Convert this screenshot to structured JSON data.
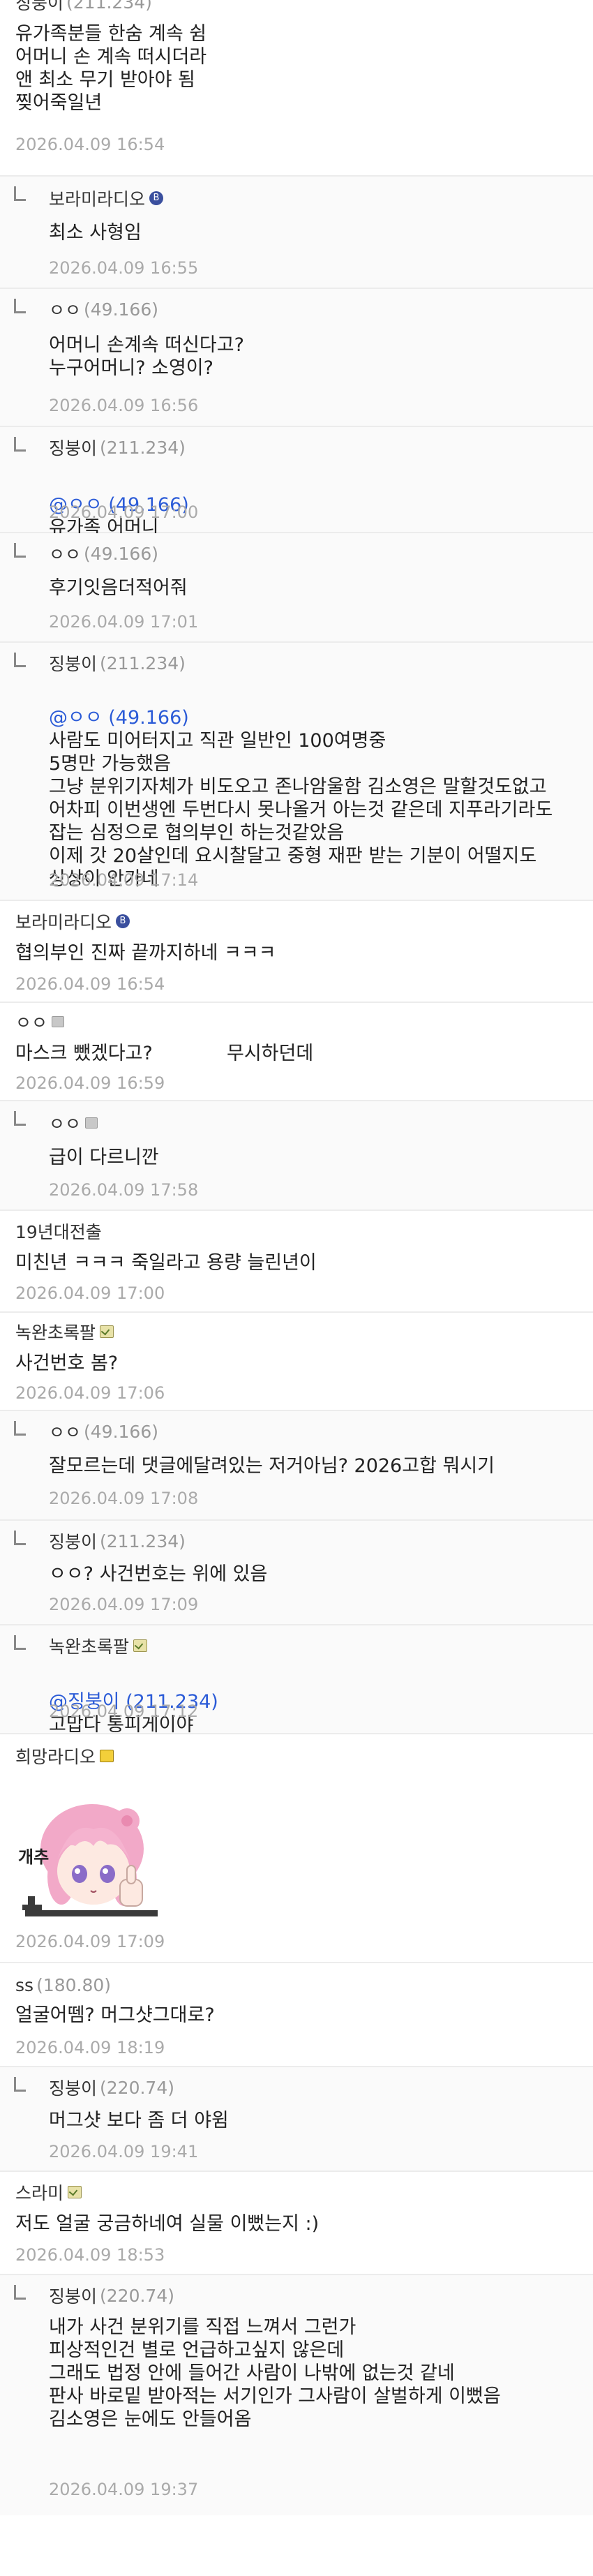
{
  "comments": [
    {
      "nick": "징붕이",
      "ip": "(211.234)",
      "text": "유가족분들 한숨 계속 쉼\n어머니 손 계속 떠시더라\n앤 최소 무기 받아야 됨\n찢어죽일년",
      "date": "2026.04.09 16:54"
    },
    {
      "nick": "보라미라디오",
      "badge": "B",
      "text": "최소 사형임",
      "date": "2026.04.09 16:55"
    },
    {
      "nick": "ㅇㅇ",
      "ip": "(49.166)",
      "text": "어머니 손계속 떠신다고?\n누구어머니? 소영이?",
      "date": "2026.04.09 16:56"
    },
    {
      "nick": "징붕이",
      "ip": "(211.234)",
      "mention": "@ㅇㅇ (49.166)",
      "text": "유가족 어머니",
      "date": "2026.04.09 17:00"
    },
    {
      "nick": "ㅇㅇ",
      "ip": "(49.166)",
      "text": "후기잇음더적어줘",
      "date": "2026.04.09 17:01"
    },
    {
      "nick": "징붕이",
      "ip": "(211.234)",
      "mention": "@ㅇㅇ (49.166)",
      "text": "사람도 미어터지고 직관 일반인 100여명중\n5명만 가능했음\n그냥 분위기자체가 비도오고 존나암울함 김소영은 말할것도없고\n어차피 이번생엔 두번다시 못나올거 아는것 같은데 지푸라기라도\n잡는 심정으로 협의부인 하는것같았음\n이제 갓 20살인데 요시찰달고 중형 재판 받는 기분이 어떨지도\n상상이 안가네",
      "date": "2026.04.09 17:14"
    },
    {
      "nick": "보라미라디오",
      "badge": "B",
      "text": "협의부인 진짜 끝까지하네 ㅋㅋㅋ",
      "date": "2026.04.09 16:54"
    },
    {
      "nick": "ㅇㅇ",
      "text": "마스크 뺐겠다고?",
      "text2": "무시하던데",
      "date": "2026.04.09 16:59"
    },
    {
      "nick": "ㅇㅇ",
      "text": "급이 다르니깐",
      "date": "2026.04.09 17:58"
    },
    {
      "nick": "19년대전출",
      "text": "미친년 ㅋㅋㅋ 죽일라고 용량 늘린년이",
      "date": "2026.04.09 17:00"
    },
    {
      "nick": "녹완초록팔",
      "text": "사건번호 봄?",
      "date": "2026.04.09 17:06"
    },
    {
      "nick": "ㅇㅇ",
      "ip": "(49.166)",
      "text": "잘모르는데 댓글에달려있는 저거아님? 2026고합 뭐시기",
      "date": "2026.04.09 17:08"
    },
    {
      "nick": "징붕이",
      "ip": "(211.234)",
      "text": "ㅇㅇ? 사건번호는 위에 있음",
      "date": "2026.04.09 17:09"
    },
    {
      "nick": "녹완초록팔",
      "mention": "@징붕이 (211.234)",
      "text": "고맙다 통피게이야",
      "date": "2026.04.09 17:12"
    },
    {
      "nick": "희망라디오",
      "sticker": "개추",
      "date": "2026.04.09 17:09"
    },
    {
      "nick": "ss",
      "ip": "(180.80)",
      "text": "얼굴어뗌? 머그샷그대로?",
      "date": "2026.04.09 18:19"
    },
    {
      "nick": "징붕이",
      "ip": "(220.74)",
      "text": "머그샷 보다 좀 더 야윔",
      "date": "2026.04.09 19:41"
    },
    {
      "nick": "스라미",
      "text": "저도 얼굴 궁금하네여 실물 이뻤는지 :)",
      "date": "2026.04.09 18:53"
    },
    {
      "nick": "징붕이",
      "ip": "(220.74)",
      "text": "내가 사건 분위기를 직접 느껴서 그런가\n피상적인건 별로 언급하고싶지 않은데\n그래도 법정 안에 들어간 사람이 나밖에 없는것 같네\n판사 바로밑 받아적는 서기인가 그사람이 살벌하게 이뻤음\n김소영은 눈에도 안들어옴",
      "date": "2026.04.09 19:37"
    }
  ]
}
